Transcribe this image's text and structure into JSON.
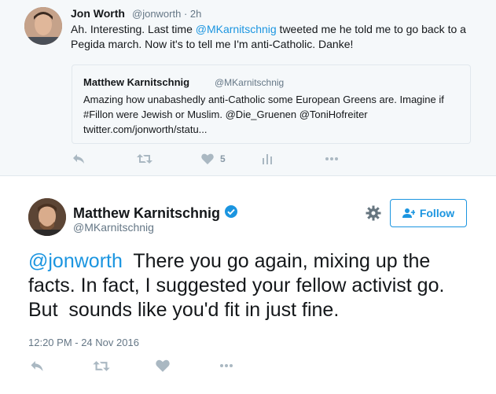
{
  "parent_tweet": {
    "name": "Jon Worth",
    "handle_time": "@jonworth · 2h",
    "text_before": "Ah. Interesting. Last time ",
    "mention": "@MKarnitschnig",
    "text_after": " tweeted me he told me to go back to a Pegida march. Now it's to tell me I'm anti-Catholic. Danke!",
    "quote": {
      "name": "Matthew Karnitschnig",
      "handle": "@MKarnitschnig",
      "text": "Amazing how unabashedly anti-Catholic some European Greens are. Imagine if #Fillon were Jewish or Muslim. @Die_Gruenen @ToniHofreiter twitter.com/jonworth/statu..."
    },
    "like_count": "5",
    "icons": [
      "reply-icon",
      "retweet-icon",
      "heart-icon",
      "analytics-icon",
      "more-icon"
    ]
  },
  "main_tweet": {
    "name": "Matthew Karnitschnig",
    "handle": "@MKarnitschnig",
    "follow_label": "Follow",
    "mention": "@jonworth",
    "text": "  There you go again, mixing up the facts. In fact, I suggested your fellow activist go. But  sounds like you'd fit in just fine.",
    "timestamp": "12:20 PM - 24 Nov 2016",
    "icons": [
      "reply-icon",
      "retweet-icon",
      "heart-icon",
      "more-icon"
    ]
  },
  "colors": {
    "accent": "#1b95e0",
    "muted": "#657786",
    "icon": "#aab8c2",
    "background_parent": "#f5f8fa"
  }
}
